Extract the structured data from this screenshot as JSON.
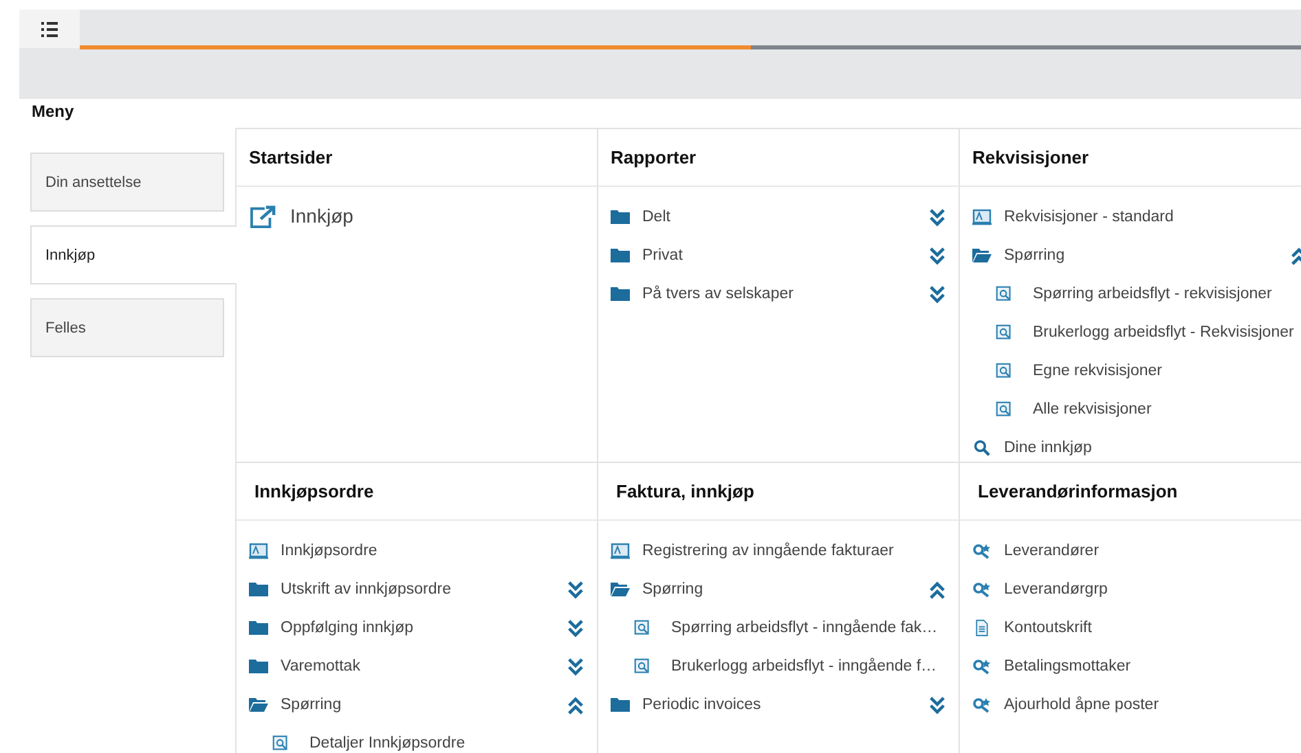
{
  "toolbar": {
    "progress": {
      "level": 0.55
    }
  },
  "menu": {
    "title": "Meny",
    "tabs": [
      {
        "label": "Din ansettelse",
        "selected": false
      },
      {
        "label": "Innkjøp",
        "selected": true
      },
      {
        "label": "Felles",
        "selected": false
      }
    ]
  },
  "sections": [
    {
      "title": "Startsider",
      "items": [
        {
          "kind": "start",
          "label": "Innkjøp"
        }
      ]
    },
    {
      "title": "Rapporter",
      "items": [
        {
          "kind": "folder",
          "label": "Delt",
          "expanded": false
        },
        {
          "kind": "folder",
          "label": "Privat",
          "expanded": false
        },
        {
          "kind": "folder",
          "label": "På tvers av selskaper",
          "expanded": false
        }
      ]
    },
    {
      "title": "Rekvisisjoner",
      "items": [
        {
          "kind": "form",
          "label": "Rekvisisjoner - standard"
        },
        {
          "kind": "folder",
          "label": "Spørring",
          "expanded": true,
          "children": [
            {
              "kind": "query",
              "label": "Spørring arbeidsflyt - rekvisisjoner"
            },
            {
              "kind": "query",
              "label": "Brukerlogg arbeidsflyt - Rekvisisjoner"
            },
            {
              "kind": "query",
              "label": "Egne rekvisisjoner"
            },
            {
              "kind": "query",
              "label": "Alle rekvisisjoner"
            }
          ]
        },
        {
          "kind": "search",
          "label": "Dine innkjøp"
        }
      ]
    },
    {
      "title": "Innkjøpsordre",
      "items": [
        {
          "kind": "form",
          "label": "Innkjøpsordre"
        },
        {
          "kind": "folder",
          "label": "Utskrift av innkjøpsordre",
          "expanded": false
        },
        {
          "kind": "folder",
          "label": "Oppfølging innkjøp",
          "expanded": false
        },
        {
          "kind": "folder",
          "label": "Varemottak",
          "expanded": false
        },
        {
          "kind": "folder",
          "label": "Spørring",
          "expanded": true,
          "children": [
            {
              "kind": "query",
              "label": "Detaljer Innkjøpsordre"
            }
          ]
        }
      ]
    },
    {
      "title": "Faktura, innkjøp",
      "items": [
        {
          "kind": "form",
          "label": "Registrering av inngående fakturaer"
        },
        {
          "kind": "folder",
          "label": "Spørring",
          "expanded": true,
          "children": [
            {
              "kind": "query",
              "label": "Spørring arbeidsflyt - inngående fak…"
            },
            {
              "kind": "query",
              "label": "Brukerlogg arbeidsflyt - inngående f…"
            }
          ]
        },
        {
          "kind": "folder",
          "label": "Periodic invoices",
          "expanded": false
        }
      ]
    },
    {
      "title": "Leverandørinformasjon",
      "items": [
        {
          "kind": "tool",
          "label": "Leverandører"
        },
        {
          "kind": "tool",
          "label": "Leverandørgrp"
        },
        {
          "kind": "document",
          "label": "Kontoutskrift"
        },
        {
          "kind": "tool",
          "label": "Betalingsmottaker"
        },
        {
          "kind": "tool",
          "label": "Ajourhold åpne poster"
        }
      ]
    }
  ]
}
